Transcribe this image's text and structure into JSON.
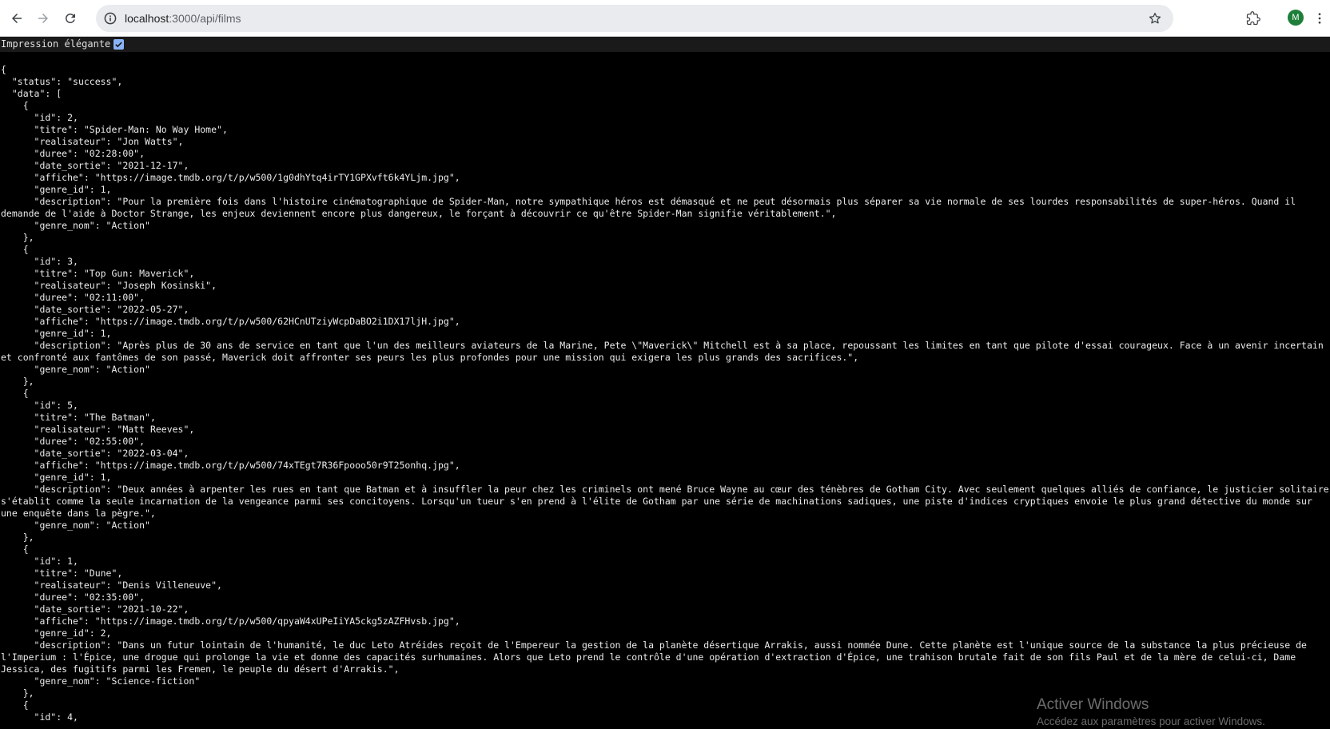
{
  "browser": {
    "url_host": "localhost",
    "url_path": ":3000/api/films",
    "profile_initial": "M",
    "pretty_print_label": "Impression élégante"
  },
  "json_lines": [
    "{",
    "  \"status\": \"success\",",
    "  \"data\": [",
    "    {",
    "      \"id\": 2,",
    "      \"titre\": \"Spider-Man: No Way Home\",",
    "      \"realisateur\": \"Jon Watts\",",
    "      \"duree\": \"02:28:00\",",
    "      \"date_sortie\": \"2021-12-17\",",
    "      \"affiche\": \"https://image.tmdb.org/t/p/w500/1g0dhYtq4irTY1GPXvft6k4YLjm.jpg\",",
    "      \"genre_id\": 1,",
    "      \"description\": \"Pour la première fois dans l'histoire cinématographique de Spider-Man, notre sympathique héros est démasqué et ne peut désormais plus séparer sa vie normale de ses lourdes responsabilités de super-héros. Quand il demande de l'aide à Doctor Strange, les enjeux deviennent encore plus dangereux, le forçant à découvrir ce qu'être Spider-Man signifie véritablement.\",",
    "      \"genre_nom\": \"Action\"",
    "    },",
    "    {",
    "      \"id\": 3,",
    "      \"titre\": \"Top Gun: Maverick\",",
    "      \"realisateur\": \"Joseph Kosinski\",",
    "      \"duree\": \"02:11:00\",",
    "      \"date_sortie\": \"2022-05-27\",",
    "      \"affiche\": \"https://image.tmdb.org/t/p/w500/62HCnUTziyWcpDaBO2i1DX17ljH.jpg\",",
    "      \"genre_id\": 1,",
    "      \"description\": \"Après plus de 30 ans de service en tant que l'un des meilleurs aviateurs de la Marine, Pete \\\"Maverick\\\" Mitchell est à sa place, repoussant les limites en tant que pilote d'essai courageux. Face à un avenir incertain et confronté aux fantômes de son passé, Maverick doit affronter ses peurs les plus profondes pour une mission qui exigera les plus grands des sacrifices.\",",
    "      \"genre_nom\": \"Action\"",
    "    },",
    "    {",
    "      \"id\": 5,",
    "      \"titre\": \"The Batman\",",
    "      \"realisateur\": \"Matt Reeves\",",
    "      \"duree\": \"02:55:00\",",
    "      \"date_sortie\": \"2022-03-04\",",
    "      \"affiche\": \"https://image.tmdb.org/t/p/w500/74xTEgt7R36Fpooo50r9T25onhq.jpg\",",
    "      \"genre_id\": 1,",
    "      \"description\": \"Deux années à arpenter les rues en tant que Batman et à insuffler la peur chez les criminels ont mené Bruce Wayne au cœur des ténèbres de Gotham City. Avec seulement quelques alliés de confiance, le justicier solitaire s'établit comme la seule incarnation de la vengeance parmi ses concitoyens. Lorsqu'un tueur s'en prend à l'élite de Gotham par une série de machinations sadiques, une piste d'indices cryptiques envoie le plus grand détective du monde sur une enquête dans la pègre.\",",
    "      \"genre_nom\": \"Action\"",
    "    },",
    "    {",
    "      \"id\": 1,",
    "      \"titre\": \"Dune\",",
    "      \"realisateur\": \"Denis Villeneuve\",",
    "      \"duree\": \"02:35:00\",",
    "      \"date_sortie\": \"2021-10-22\",",
    "      \"affiche\": \"https://image.tmdb.org/t/p/w500/qpyaW4xUPeIiYA5ckg5zAZFHvsb.jpg\",",
    "      \"genre_id\": 2,",
    "      \"description\": \"Dans un futur lointain de l'humanité, le duc Leto Atréides reçoit de l'Empereur la gestion de la planète désertique Arrakis, aussi nommée Dune. Cette planète est l'unique source de la substance la plus précieuse de l'Imperium : l'Épice, une drogue qui prolonge la vie et donne des capacités surhumaines. Alors que Leto prend le contrôle d'une opération d'extraction d'Épice, une trahison brutale fait de son fils Paul et de la mère de celui-ci, Dame Jessica, des fugitifs parmi les Fremen, le peuple du désert d'Arrakis.\",",
    "      \"genre_nom\": \"Science-fiction\"",
    "    },",
    "    {",
    "      \"id\": 4,"
  ],
  "watermark": {
    "title": "Activer Windows",
    "subtitle": "Accédez aux paramètres pour activer Windows."
  }
}
